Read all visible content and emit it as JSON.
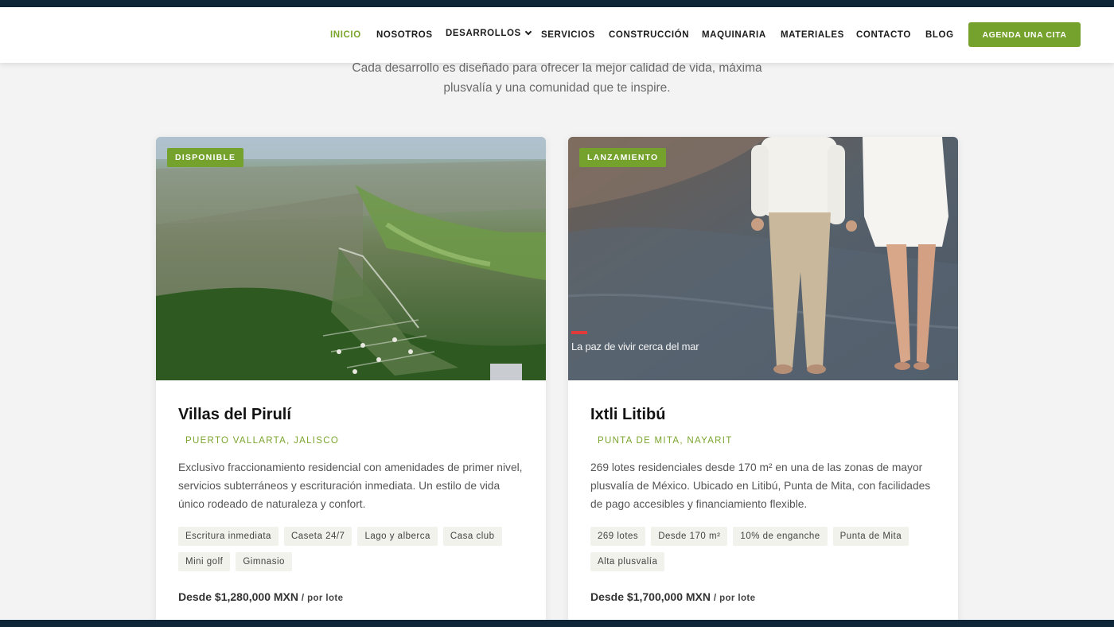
{
  "nav": {
    "items": [
      {
        "label": "INICIO",
        "active": true
      },
      {
        "label": "NOSOTROS"
      },
      {
        "label": "DESARROLLOS",
        "dropdown": true
      },
      {
        "label": "SERVICIOS"
      },
      {
        "label": "CONSTRUCCIÓN"
      },
      {
        "label": "MAQUINARIA"
      },
      {
        "label": "MATERIALES"
      },
      {
        "label": "CONTACTO"
      },
      {
        "label": "BLOG"
      }
    ],
    "cta_label": "AGENDA UNA CITA"
  },
  "intro": {
    "line1": "Cada desarrollo es diseñado para ofrecer la mejor calidad de vida, máxima",
    "line2": "plusvalía y una comunidad que te inspire."
  },
  "cards": [
    {
      "badge": "DISPONIBLE",
      "title": "Villas del Pirulí",
      "location": "PUERTO VALLARTA, JALISCO",
      "description": "Exclusivo fraccionamiento residencial con amenidades de primer nivel, servicios subterráneos y escrituración inmediata. Un estilo de vida único rodeado de naturaleza y confort.",
      "tags": [
        "Escritura inmediata",
        "Caseta 24/7",
        "Lago y alberca",
        "Casa club",
        "Mini golf",
        "Gimnasio"
      ],
      "price": "Desde $1,280,000 MXN",
      "price_unit": "/ por lote"
    },
    {
      "badge": "LANZAMIENTO",
      "title": "Ixtli Litibú",
      "location": "PUNTA DE MITA, NAYARIT",
      "description": "269 lotes residenciales desde 170 m² en una de las zonas de mayor plusvalía de México. Ubicado en Litibú, Punta de Mita, con facilidades de pago accesibles y financiamiento flexible.",
      "tags": [
        "269 lotes",
        "Desde 170 m²",
        "10% de enganche",
        "Punta de Mita",
        "Alta plusvalía"
      ],
      "price": "Desde $1,700,000 MXN",
      "price_unit": "/ por lote",
      "image_caption": "La paz de vivir cerca del mar"
    }
  ],
  "colors": {
    "accent": "#74a22c",
    "navy": "#0f2538",
    "background": "#f3f3f3"
  }
}
